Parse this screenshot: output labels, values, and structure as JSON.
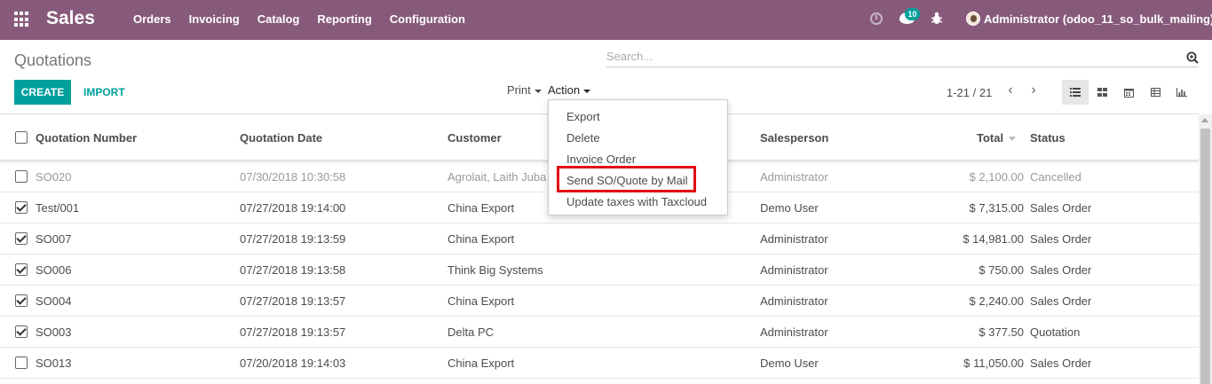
{
  "navbar": {
    "app_name": "Sales",
    "menu": [
      "Orders",
      "Invoicing",
      "Catalog",
      "Reporting",
      "Configuration"
    ],
    "chat_count": "10",
    "user_label": "Administrator (odoo_11_so_bulk_mailing)",
    "bg_color": "#875a7b"
  },
  "control_panel": {
    "title": "Quotations",
    "search_placeholder": "Search...",
    "create_label": "CREATE",
    "import_label": "IMPORT",
    "print_label": "Print",
    "action_label": "Action",
    "pager": "1-21 / 21",
    "accent_color": "#00a09d"
  },
  "action_menu": {
    "items": [
      "Export",
      "Delete",
      "Invoice Order",
      "Send SO/Quote by Mail",
      "Update taxes with Taxcloud"
    ],
    "highlighted_item": "Send SO/Quote by Mail",
    "highlight_color": "#e30613"
  },
  "table": {
    "columns": [
      "Quotation Number",
      "Quotation Date",
      "Customer",
      "Salesperson",
      "Total",
      "Status"
    ],
    "rows": [
      {
        "number": "SO020",
        "date": "07/30/2018 10:30:58",
        "customer": "Agrolait, Laith Juba",
        "salesperson": "Administrator",
        "total": "$ 2,100.00",
        "status": "Cancelled",
        "checked": false,
        "cancelled": true
      },
      {
        "number": "Test/001",
        "date": "07/27/2018 19:14:00",
        "customer": "China Export",
        "salesperson": "Demo User",
        "total": "$ 7,315.00",
        "status": "Sales Order",
        "checked": true,
        "cancelled": false
      },
      {
        "number": "SO007",
        "date": "07/27/2018 19:13:59",
        "customer": "China Export",
        "salesperson": "Administrator",
        "total": "$ 14,981.00",
        "status": "Sales Order",
        "checked": true,
        "cancelled": false
      },
      {
        "number": "SO006",
        "date": "07/27/2018 19:13:58",
        "customer": "Think Big Systems",
        "salesperson": "Administrator",
        "total": "$ 750.00",
        "status": "Sales Order",
        "checked": true,
        "cancelled": false
      },
      {
        "number": "SO004",
        "date": "07/27/2018 19:13:57",
        "customer": "China Export",
        "salesperson": "Administrator",
        "total": "$ 2,240.00",
        "status": "Sales Order",
        "checked": true,
        "cancelled": false
      },
      {
        "number": "SO003",
        "date": "07/27/2018 19:13:57",
        "customer": "Delta PC",
        "salesperson": "Administrator",
        "total": "$ 377.50",
        "status": "Quotation",
        "checked": true,
        "cancelled": false
      },
      {
        "number": "SO013",
        "date": "07/20/2018 19:14:03",
        "customer": "China Export",
        "salesperson": "Demo User",
        "total": "$ 11,050.00",
        "status": "Sales Order",
        "checked": false,
        "cancelled": false
      }
    ]
  }
}
